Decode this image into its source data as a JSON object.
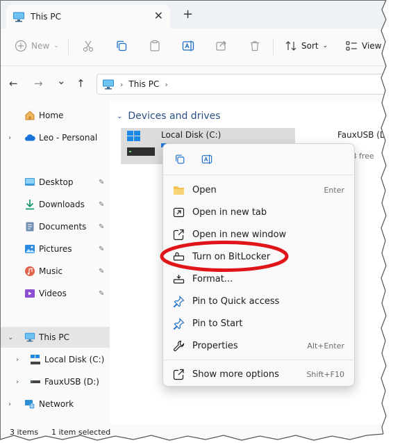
{
  "window": {
    "tab_title": "This PC",
    "tab_close_glyph": "✕",
    "new_tab_glyph": "+"
  },
  "toolbar": {
    "new_label": "New",
    "sort_label": "Sort",
    "view_label": "View",
    "icons": [
      "cut-icon",
      "copy-icon",
      "paste-icon",
      "rename-icon",
      "share-icon",
      "delete-icon"
    ]
  },
  "address": {
    "back_glyph": "←",
    "forward_glyph": "→",
    "recent_glyph": "⌄",
    "up_glyph": "↑",
    "crumb": "This PC",
    "crumb_sep": "›"
  },
  "sidebar": {
    "chevron_glyph": "›",
    "expanded_glyph": "⌄",
    "pin_glyph": "📌",
    "items": [
      {
        "label": "Home"
      },
      {
        "label": "Leo - Personal"
      },
      {
        "label": "Desktop"
      },
      {
        "label": "Downloads"
      },
      {
        "label": "Documents"
      },
      {
        "label": "Pictures"
      },
      {
        "label": "Music"
      },
      {
        "label": "Videos"
      },
      {
        "label": "This PC"
      },
      {
        "label": "Local Disk (C:)"
      },
      {
        "label": "FauxUSB (D:)"
      },
      {
        "label": "Network"
      }
    ]
  },
  "main": {
    "group_chevron": "⌄",
    "group_title": "Devices and drives",
    "drive_c": {
      "name": "Local Disk (C:)",
      "used_fraction": 0.3
    },
    "drive_d": {
      "name": "FauxUSB (D:",
      "free_text": "B free"
    }
  },
  "status": {
    "items_count": "3 items",
    "selected": "1 item selected"
  },
  "context_menu": {
    "items": [
      {
        "label": "Open",
        "shortcut": "Enter"
      },
      {
        "label": "Open in new tab",
        "shortcut": ""
      },
      {
        "label": "Open in new window",
        "shortcut": ""
      },
      {
        "label": "Turn on BitLocker",
        "shortcut": ""
      },
      {
        "label": "Format...",
        "shortcut": ""
      },
      {
        "label": "Pin to Quick access",
        "shortcut": ""
      },
      {
        "label": "Pin to Start",
        "shortcut": ""
      },
      {
        "label": "Properties",
        "shortcut": "Alt+Enter"
      },
      {
        "label": "Show more options",
        "shortcut": "Shift+F10"
      }
    ]
  },
  "colors": {
    "accent": "#2678d4",
    "annotation": "#e0151a",
    "selection": "#dcdcdc",
    "group_header": "#2a4f84"
  }
}
